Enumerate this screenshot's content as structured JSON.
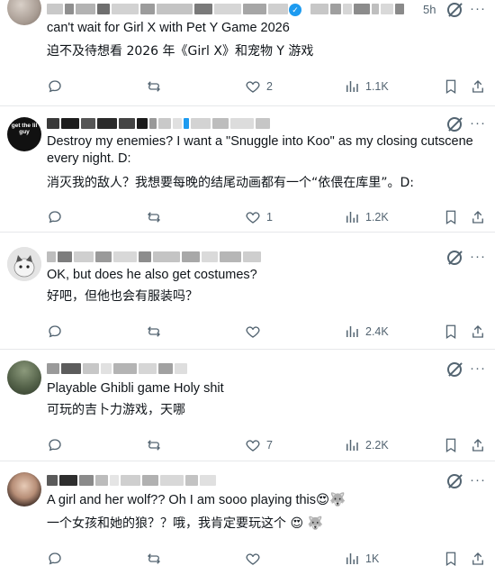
{
  "posts": [
    {
      "time": "5h",
      "verified": true,
      "text_en": "can't wait for Girl X with Pet Y Game 2026",
      "text_zh": "迫不及待想看 2026 年《Girl X》和宠物 Y 游戏",
      "likes": "2",
      "views": "1.1K",
      "replies": "",
      "reposts": ""
    },
    {
      "text_en": "Destroy my enemies? I want a \"Snuggle into Koo\" as my closing cutscene every  night. D:",
      "text_zh": "消灭我的敌人？我想要每晚的结尾动画都有一个“依偎在库里”。D:",
      "likes": "1",
      "views": "1.2K",
      "replies": "",
      "reposts": "",
      "avatar_text": "get the lil guy"
    },
    {
      "text_en": "OK, but does he also get costumes?",
      "text_zh": "好吧，但他也会有服装吗？",
      "likes": "",
      "views": "2.4K",
      "replies": "",
      "reposts": ""
    },
    {
      "text_en": "Playable Ghibli game Holy shit",
      "text_zh": "可玩的吉卜力游戏，天哪",
      "likes": "7",
      "views": "2.2K",
      "replies": "",
      "reposts": ""
    },
    {
      "text_en": "A girl and her wolf?? Oh I am sooo playing this😍🐺",
      "text_zh": "一个女孩和她的狼？？哦，我肯定要玩这个 😍 🐺",
      "likes": "",
      "views": "1K",
      "replies": "",
      "reposts": ""
    }
  ],
  "icons": {
    "reply": "reply-icon",
    "repost": "repost-icon",
    "like": "heart-icon",
    "views": "views-chart-icon",
    "bookmark": "bookmark-icon",
    "share": "share-icon",
    "grok": "grok-icon",
    "more": "more-icon",
    "verified": "verified-badge-icon"
  },
  "colors": {
    "icon_gray": "#536471",
    "verified_blue": "#1d9bf0",
    "divider": "#e6e8ea",
    "text": "#0f1419"
  }
}
